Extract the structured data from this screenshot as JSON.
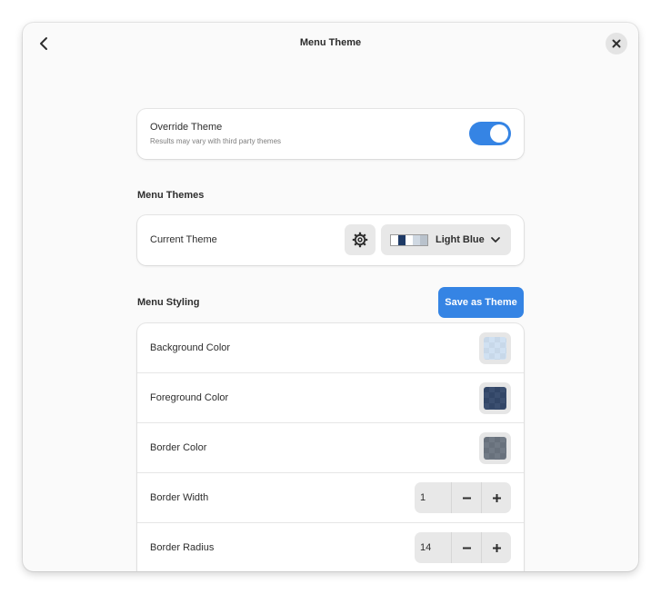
{
  "header": {
    "title": "Menu Theme"
  },
  "override": {
    "title": "Override Theme",
    "subtitle": "Results may vary with third party themes",
    "enabled": true
  },
  "menu_themes": {
    "section_title": "Menu Themes",
    "current_theme_label": "Current Theme",
    "selected_theme": "Light Blue",
    "swatch_colors": [
      "#ffffff",
      "#1e3a66",
      "#ffffff",
      "#cfd8e2",
      "#b9c2cc"
    ]
  },
  "menu_styling": {
    "section_title": "Menu Styling",
    "save_button_label": "Save as Theme",
    "rows": [
      {
        "label": "Background Color",
        "color": "#c9dcf0"
      },
      {
        "label": "Foreground Color",
        "color": "#1d345a"
      },
      {
        "label": "Border Color",
        "color": "#5b6572"
      },
      {
        "label": "Border Width",
        "value": "1"
      },
      {
        "label": "Border Radius",
        "value": "14"
      }
    ]
  },
  "colors": {
    "accent": "#3584e4"
  }
}
